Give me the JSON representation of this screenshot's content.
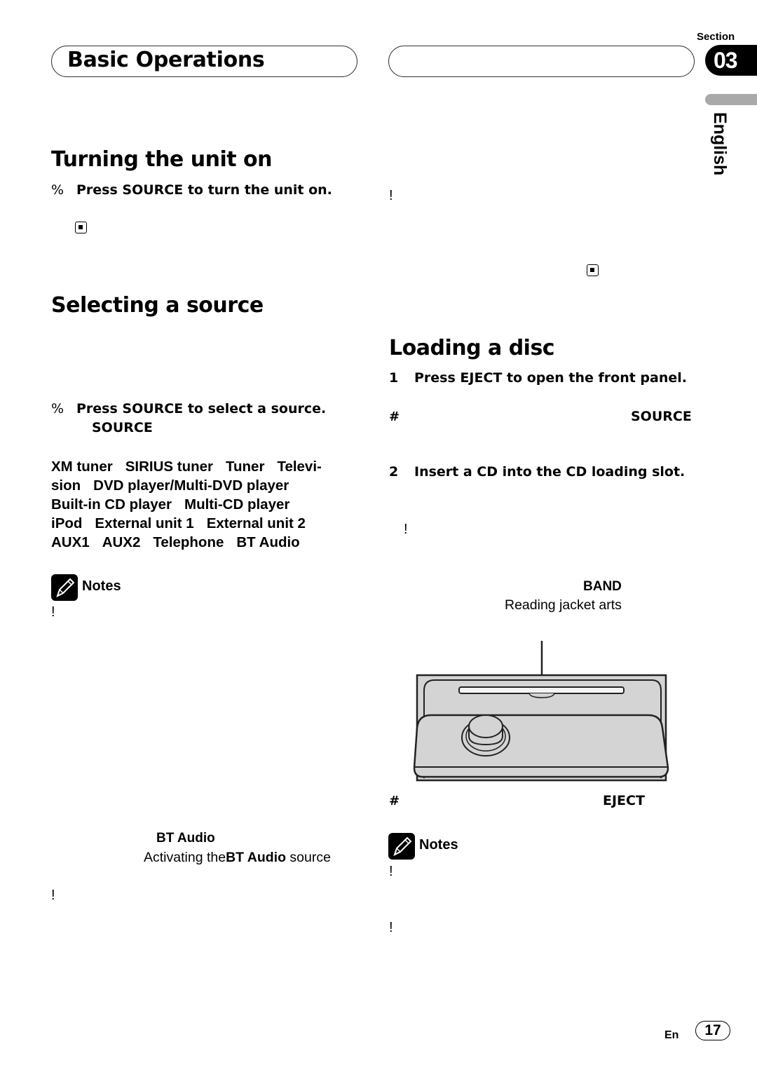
{
  "header": {
    "chapter_title": "Basic Operations",
    "section_label": "Section",
    "section_number": "03",
    "language_tab": "English"
  },
  "left_column": {
    "turning_on": {
      "heading": "Turning the unit on",
      "step_marker": "%",
      "step_text": "Press SOURCE to turn the unit on."
    },
    "selecting_source": {
      "heading": "Selecting a source",
      "step_marker": "%",
      "step_text": "Press SOURCE to select a source.",
      "step_sub": "SOURCE",
      "sources": [
        "XM tuner",
        "SIRIUS tuner",
        "Tuner",
        "Televi-",
        "sion",
        "DVD player/Multi-DVD player",
        "Built-in CD player",
        "Multi-CD player",
        "iPod",
        "External unit 1",
        "External unit 2",
        "AUX1",
        "AUX2",
        "Telephone",
        "BT Audio"
      ]
    },
    "notes": {
      "label": "Notes",
      "bullet1": "!",
      "ref_bold": "BT Audio",
      "ref_prefix": "Activating the",
      "ref_bold2": "BT Audio",
      "ref_suffix": "source",
      "bullet2": "!"
    }
  },
  "right_column": {
    "top_bullet": "!",
    "loading_disc": {
      "heading": "Loading a disc",
      "step1_num": "1",
      "step1_text": "Press EJECT to open the front panel.",
      "hash1": "#",
      "hash1_keyword": "SOURCE",
      "step2_num": "2",
      "step2_text": "Insert a CD into the CD loading slot.",
      "bullet": "!",
      "band_keyword": "BAND",
      "ref_text": "Reading jacket arts",
      "hash2": "#",
      "hash2_keyword": "EJECT"
    },
    "notes": {
      "label": "Notes",
      "bullet1": "!",
      "bullet2": "!"
    }
  },
  "footer": {
    "lang": "En",
    "page_number": "17"
  },
  "colors": {
    "panel_fill": "#d4d4d4",
    "language_bar": "#a9a9a9"
  }
}
